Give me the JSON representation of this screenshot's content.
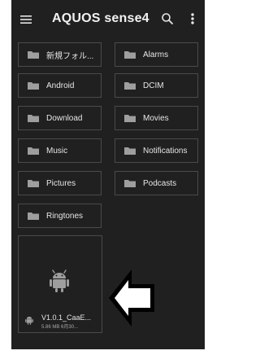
{
  "app_bar": {
    "title": "AQUOS sense4",
    "menu_icon": "hamburger-menu-icon",
    "search_icon": "search-icon",
    "more_icon": "more-vert-icon"
  },
  "folders": [
    {
      "label": "新規フォル..."
    },
    {
      "label": "Alarms"
    },
    {
      "label": "Android"
    },
    {
      "label": "DCIM"
    },
    {
      "label": "Download"
    },
    {
      "label": "Movies"
    },
    {
      "label": "Music"
    },
    {
      "label": "Notifications"
    },
    {
      "label": "Pictures"
    },
    {
      "label": "Podcasts"
    },
    {
      "label": "Ringtones"
    }
  ],
  "file": {
    "name": "V1.0.1_CaaE...",
    "meta": "5.86 MB 6月30...",
    "thumbnail_icon": "android-icon"
  },
  "annotation": {
    "icon": "left-arrow-icon"
  },
  "colors": {
    "background": "#202020",
    "border": "#4a4a4a",
    "text": "#e6e6e6",
    "icon": "#9e9e9e"
  }
}
